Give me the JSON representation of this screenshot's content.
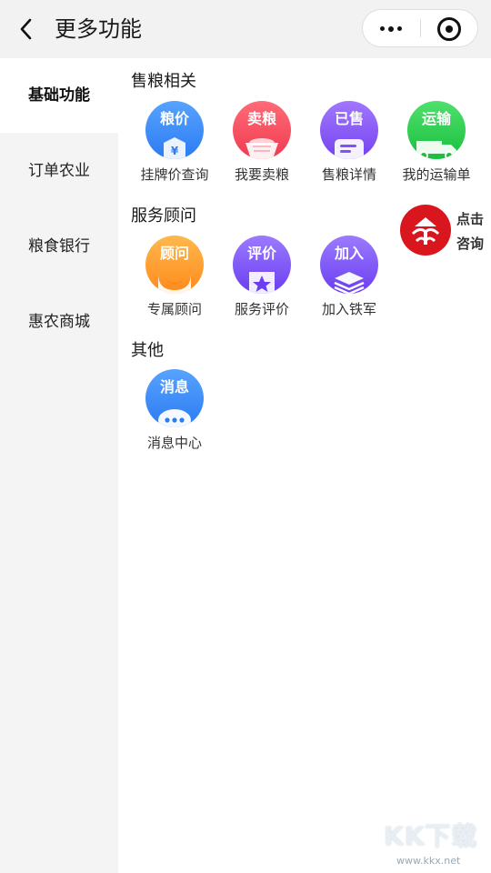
{
  "header": {
    "title": "更多功能",
    "back_icon": "chevron-left-icon",
    "more_icon": "more-dots-icon",
    "close_icon": "target-circle-icon"
  },
  "sidebar": {
    "items": [
      {
        "label": "基础功能",
        "active": true
      },
      {
        "label": "订单农业",
        "active": false
      },
      {
        "label": "粮食银行",
        "active": false
      },
      {
        "label": "惠农商城",
        "active": false
      }
    ]
  },
  "sections": [
    {
      "title": "售粮相关",
      "items": [
        {
          "icon_text": "粮价",
          "label": "挂牌价查询",
          "color": "#3d8ef7",
          "icon": "yen-tag-icon"
        },
        {
          "icon_text": "卖粮",
          "label": "我要卖粮",
          "color": "#f24b5c",
          "icon": "grain-basket-icon"
        },
        {
          "icon_text": "已售",
          "label": "售粮详情",
          "color": "#8352f2",
          "icon": "document-icon"
        },
        {
          "icon_text": "运输",
          "label": "我的运输单",
          "color": "#22c847",
          "icon": "truck-icon"
        }
      ]
    },
    {
      "title": "服务顾问",
      "items": [
        {
          "icon_text": "顾问",
          "label": "专属顾问",
          "color": "#ff9a2a",
          "icon": "advisor-icon"
        },
        {
          "icon_text": "评价",
          "label": "服务评价",
          "color": "#7b4df2",
          "icon": "star-badge-icon"
        },
        {
          "icon_text": "加入",
          "label": "加入铁军",
          "color": "#7b4df2",
          "icon": "layers-icon"
        }
      ]
    },
    {
      "title": "其他",
      "items": [
        {
          "icon_text": "消息",
          "label": "消息中心",
          "color": "#3d8ef7",
          "icon": "chat-dots-icon"
        }
      ]
    }
  ],
  "consult": {
    "line1": "点击",
    "line2": "咨询",
    "color": "#d9161e",
    "icon": "consult-logo-icon"
  },
  "watermark": {
    "big": "KK下载",
    "small": "www.kkx.net"
  }
}
